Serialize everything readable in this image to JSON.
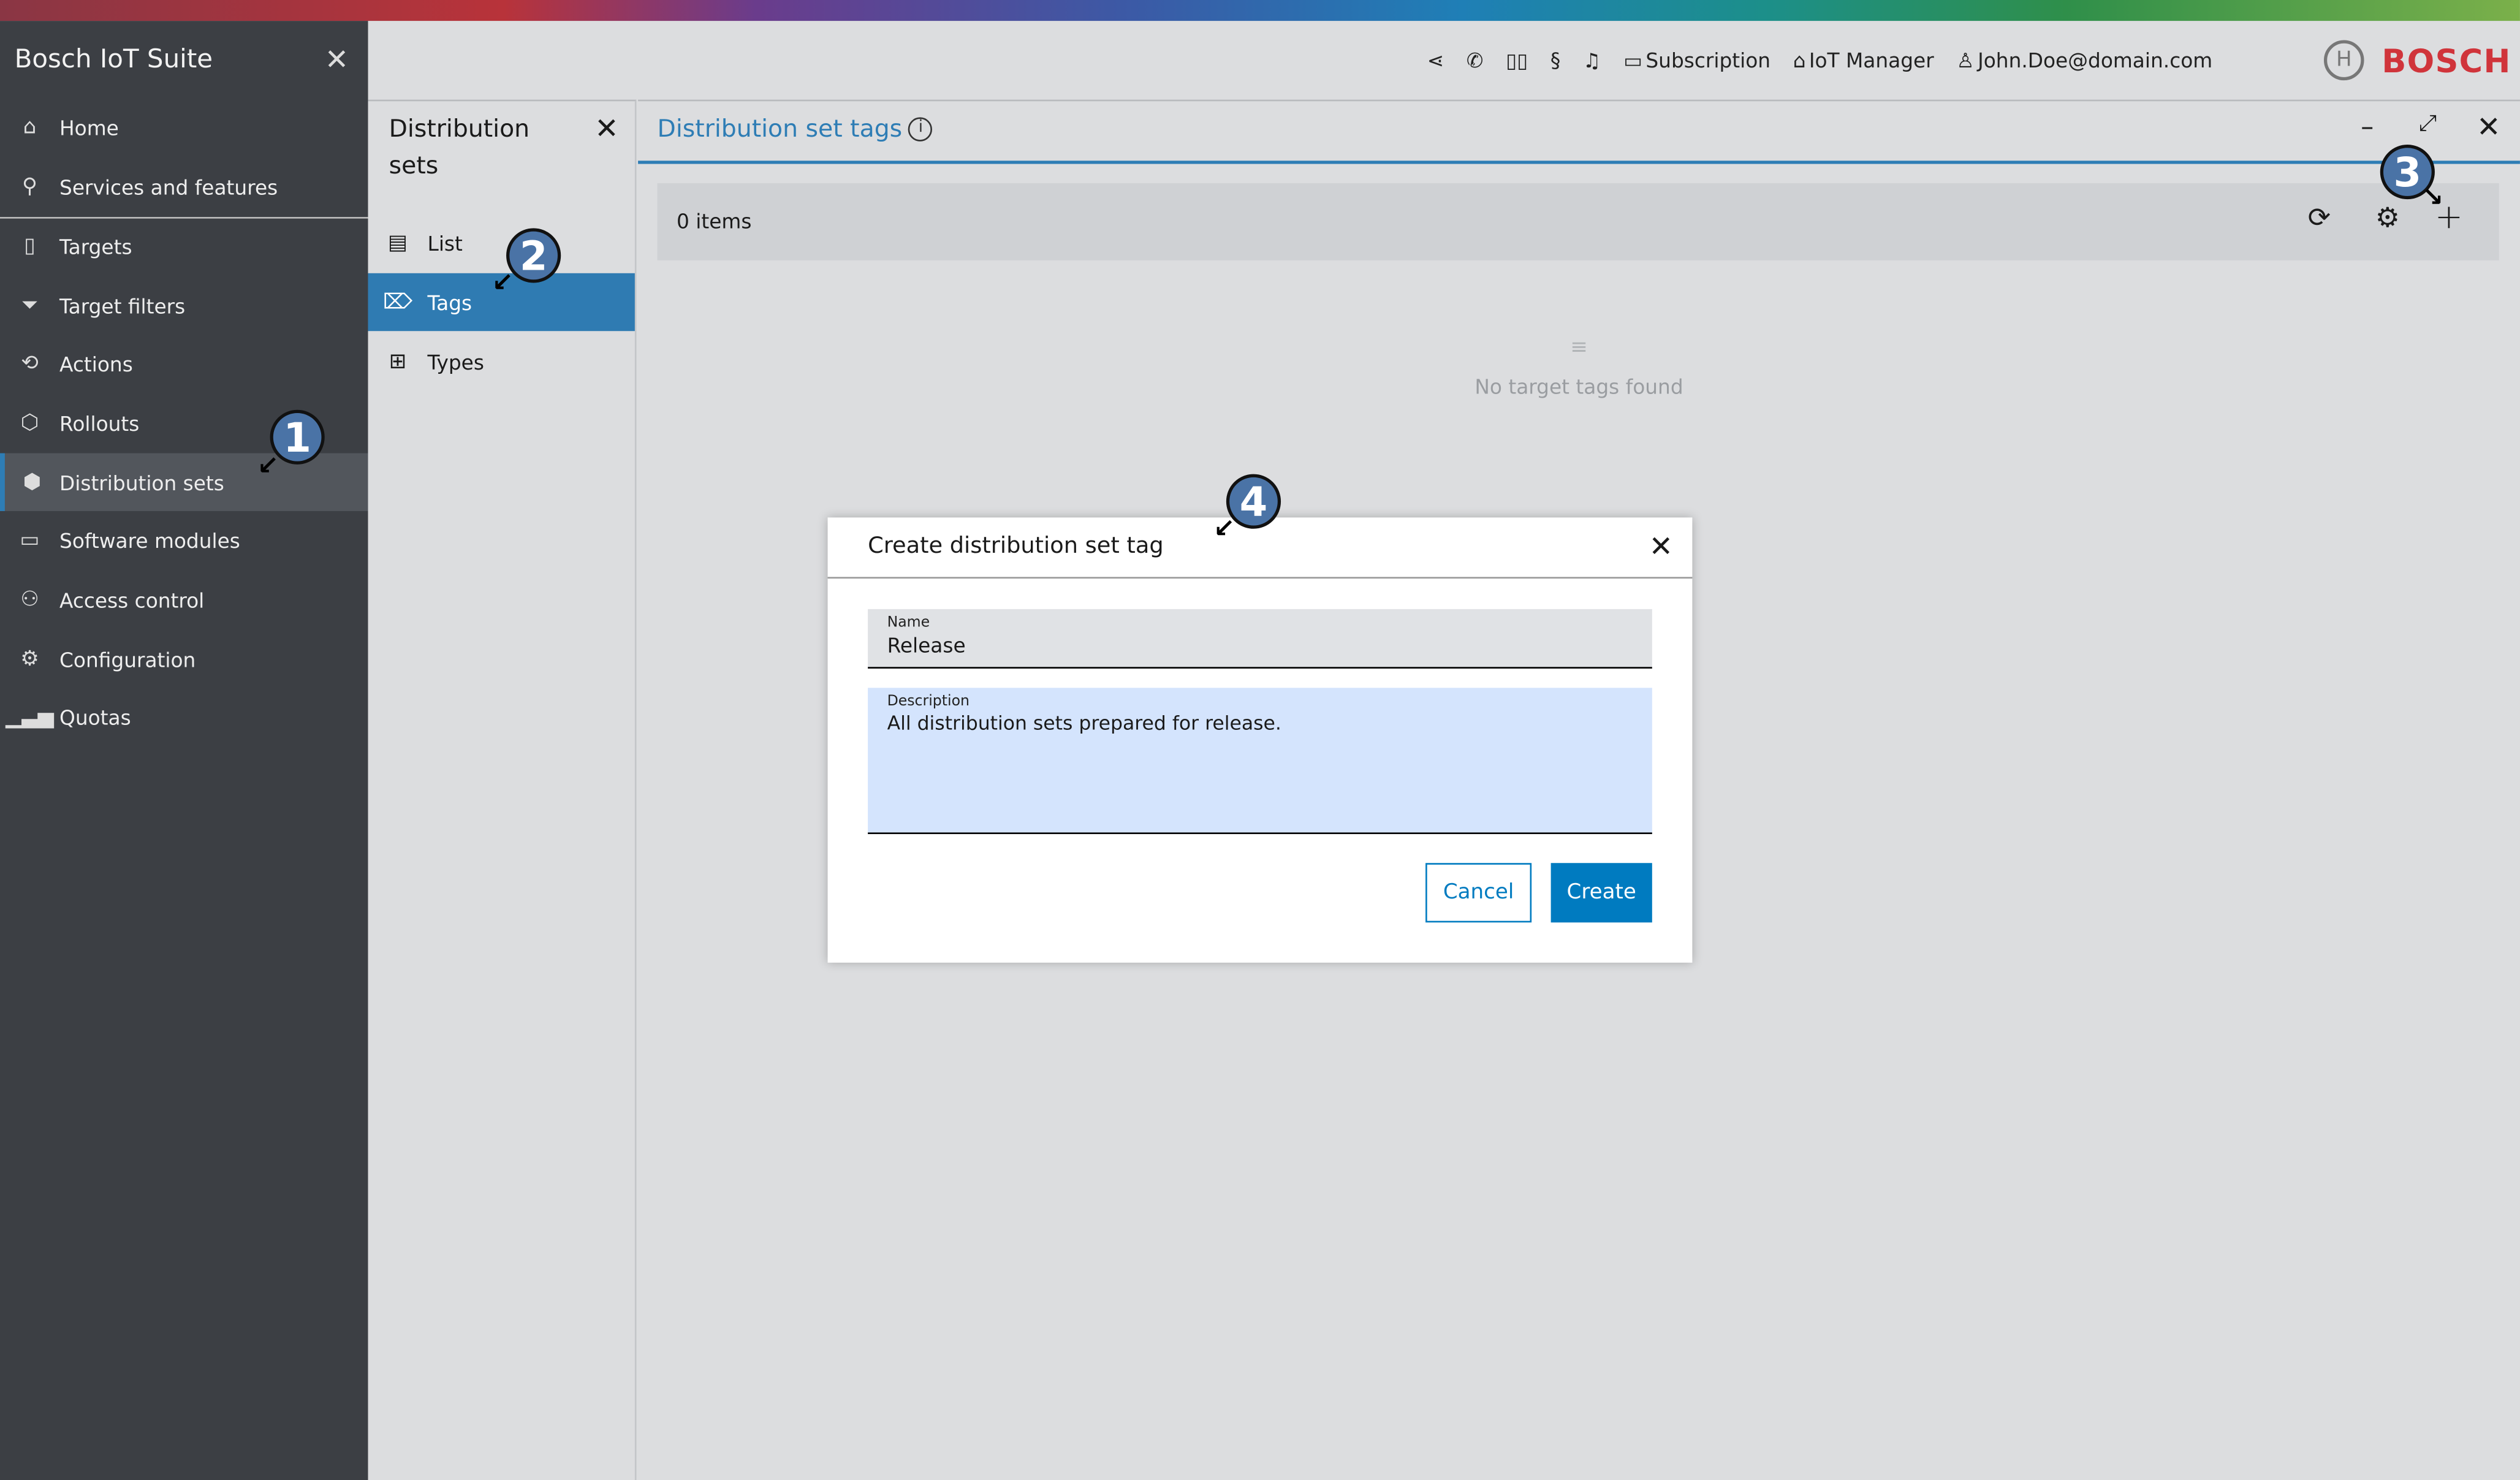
{
  "app": {
    "title": "Bosch IoT Suite",
    "logo_text": "BOSCH"
  },
  "sidebar": {
    "items": [
      {
        "label": "Home",
        "icon": "home-icon"
      },
      {
        "label": "Services and features",
        "icon": "search-icon"
      },
      {
        "label": "Targets",
        "icon": "device-icon"
      },
      {
        "label": "Target filters",
        "icon": "filter-icon"
      },
      {
        "label": "Actions",
        "icon": "actions-icon"
      },
      {
        "label": "Rollouts",
        "icon": "box-icon"
      },
      {
        "label": "Distribution sets",
        "icon": "package-icon"
      },
      {
        "label": "Software modules",
        "icon": "modules-icon"
      },
      {
        "label": "Access control",
        "icon": "users-icon"
      },
      {
        "label": "Configuration",
        "icon": "gear-icon"
      },
      {
        "label": "Quotas",
        "icon": "bar-chart-icon"
      }
    ],
    "active": "Distribution sets"
  },
  "header": {
    "subscription": "Subscription",
    "manager": "IoT Manager",
    "user": "John.Doe@domain.com"
  },
  "subnav": {
    "title": "Distribution sets",
    "items": [
      {
        "label": "List"
      },
      {
        "label": "Tags"
      },
      {
        "label": "Types"
      }
    ],
    "active": "Tags"
  },
  "main": {
    "title": "Distribution set tags",
    "items_count": "0 items",
    "empty_text": "No target tags found"
  },
  "dialog": {
    "title": "Create distribution set tag",
    "name_label": "Name",
    "name_value": "Release",
    "description_label": "Description",
    "description_value": "All distribution sets prepared for release.",
    "cancel": "Cancel",
    "create": "Create"
  },
  "callouts": [
    "1",
    "2",
    "3",
    "4"
  ],
  "colors": {
    "accent": "#2e7db5",
    "primary_button": "#007bc0",
    "brand": "#d0343b",
    "sidebar": "#3c3f44"
  }
}
